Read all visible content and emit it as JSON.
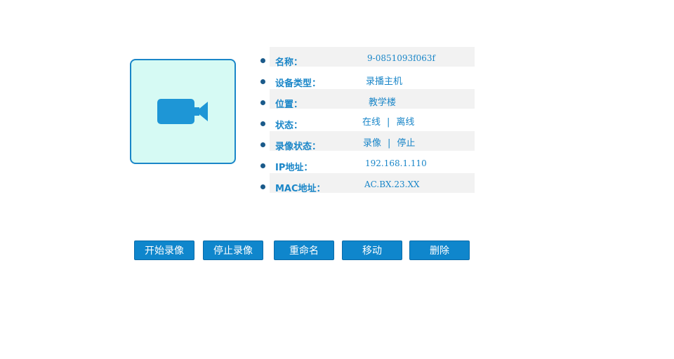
{
  "device": {
    "icon": "video-camera-icon",
    "icon_color": "#1e96d6",
    "box_bg": "#d6faf4",
    "box_border": "#1a86c8"
  },
  "info": {
    "name_label": "名称：",
    "name_value": "9-0851093f063f",
    "type_label": "设备类型：",
    "type_value": "录播主机",
    "location_label": "位置：",
    "location_value": "教学楼",
    "status_label": "状态：",
    "status_online": "在线",
    "status_offline": "离线",
    "record_label": "录像状态：",
    "record_on": "录像",
    "record_off": "停止",
    "ip_label": "IP地址：",
    "ip_value": "192.168.1.110",
    "mac_label": "MAC地址：",
    "mac_value": "AC.BX.23.XX",
    "separator": "|"
  },
  "buttons": {
    "start_record": "开始录像",
    "stop_record": "停止录像",
    "rename": "重命名",
    "move": "移动",
    "delete": "删除"
  },
  "colors": {
    "accent": "#1a86c8",
    "button_bg": "#0f86cc",
    "row_shade": "#f2f2f2"
  }
}
